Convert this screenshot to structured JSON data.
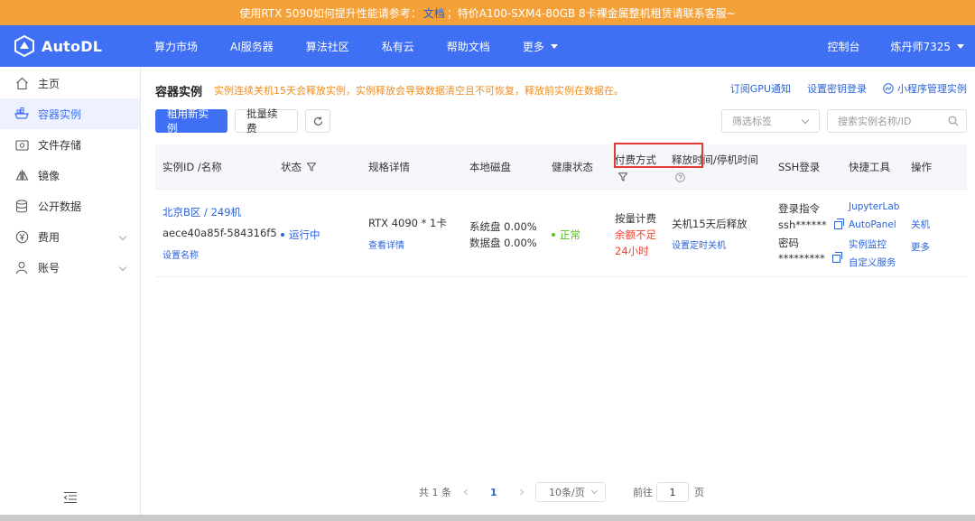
{
  "banner": {
    "text_before": "使用RTX 5090如何提升性能请参考：",
    "link": "文档",
    "text_after": "；特价A100-SXM4-80GB 8卡裸金属整机租赁请联系客服~"
  },
  "header": {
    "brand": "AutoDL",
    "nav": [
      "算力市场",
      "AI服务器",
      "算法社区",
      "私有云",
      "帮助文档",
      "更多"
    ],
    "console": "控制台",
    "user": "炼丹师7325"
  },
  "sidebar": {
    "items": [
      {
        "label": "主页",
        "icon": "home-icon"
      },
      {
        "label": "容器实例",
        "icon": "container-icon"
      },
      {
        "label": "文件存储",
        "icon": "storage-icon"
      },
      {
        "label": "镜像",
        "icon": "image-icon"
      },
      {
        "label": "公开数据",
        "icon": "database-icon"
      },
      {
        "label": "费用",
        "icon": "yen-icon"
      },
      {
        "label": "账号",
        "icon": "user-icon"
      }
    ]
  },
  "page": {
    "title": "容器实例",
    "warning": "实例连续关机15天会释放实例，实例释放会导致数据清空且不可恢复，释放前实例在数据在。",
    "links": [
      "订阅GPU通知",
      "设置密钥登录",
      "小程序管理实例"
    ]
  },
  "toolbar": {
    "new_instance": "租用新实例",
    "batch_renew": "批量续费",
    "filter_placeholder": "筛选标签",
    "search_placeholder": "搜索实例名称/ID"
  },
  "table": {
    "headers": {
      "id": "实例ID /名称",
      "status": "状态",
      "spec": "规格详情",
      "disk": "本地磁盘",
      "health": "健康状态",
      "billing": "付费方式",
      "release": "释放时间/停机时间",
      "ssh": "SSH登录",
      "tools": "快捷工具",
      "ops": "操作"
    },
    "row": {
      "region_name": "北京B区 / 249机",
      "instance_id": "aece40a85f-584316f5",
      "set_name": "设置名称",
      "status": "运行中",
      "gpu": "RTX 4090 * 1卡",
      "view_details": "查看详情",
      "system_disk": "系统盘 0.00%",
      "data_disk": "数据盘 0.00%",
      "health": "正常",
      "billing": "按量计费",
      "balance_warn_1": "余额不足",
      "balance_warn_2": "24小时",
      "release": "关机15天后释放",
      "set_shutdown": "设置定时关机",
      "login_cmd_label": "登录指令",
      "login_cmd": "ssh******",
      "password_label": "密码",
      "password": "*********",
      "tools": [
        "JupyterLab",
        "AutoPanel",
        "实例监控",
        "自定义服务"
      ],
      "ops": [
        "关机",
        "更多"
      ]
    }
  },
  "pagination": {
    "total": "共 1 条",
    "current": "1",
    "page_size": "10条/页",
    "goto_label": "前往",
    "goto_value": "1",
    "page_unit": "页"
  },
  "colors": {
    "banner": "#f5a13a",
    "header": "#3f6ff2",
    "link": "#2b63d9",
    "warning": "#f08c1c",
    "danger": "#f04134",
    "success": "#52c41a"
  }
}
